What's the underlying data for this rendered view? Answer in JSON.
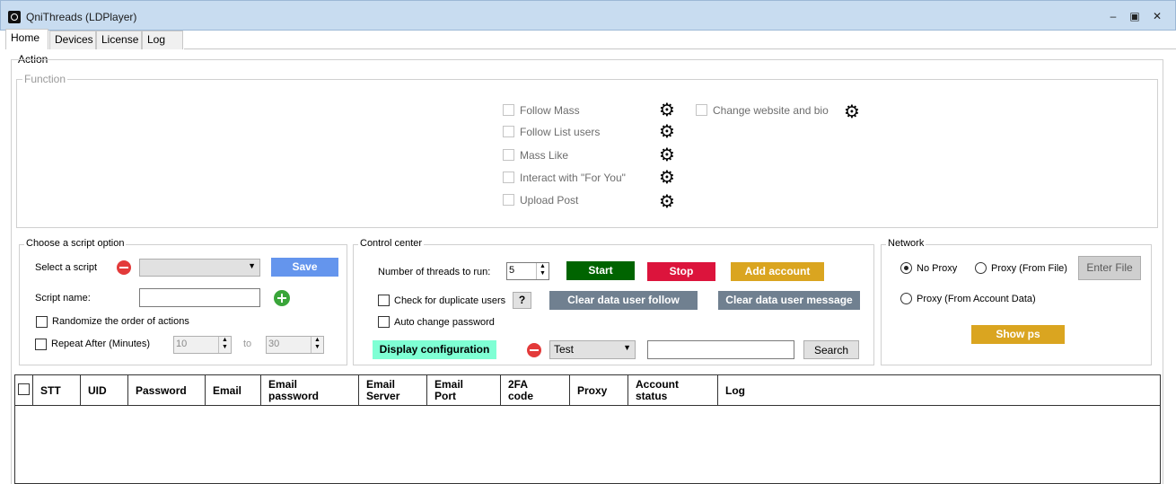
{
  "window": {
    "title": "QniThreads (LDPlayer)"
  },
  "tabs": [
    {
      "label": "Home"
    },
    {
      "label": "Devices"
    },
    {
      "label": "License"
    },
    {
      "label": "Log"
    }
  ],
  "action": {
    "label": "Action",
    "function_label": "Function",
    "functions_left": [
      {
        "label": "Follow Mass"
      },
      {
        "label": "Follow List users"
      },
      {
        "label": "Mass Like"
      },
      {
        "label": "Interact with \"For You\""
      },
      {
        "label": "Upload Post"
      }
    ],
    "functions_right": [
      {
        "label": "Change website and bio"
      }
    ]
  },
  "script_option": {
    "label": "Choose a script option",
    "select_label": "Select a script",
    "select_value": "",
    "save_label": "Save",
    "name_label": "Script name:",
    "name_value": "",
    "randomize_label": "Randomize the order of actions",
    "repeat_label": "Repeat After (Minutes)",
    "repeat_from": "10",
    "to_label": "to",
    "repeat_to": "30"
  },
  "control": {
    "label": "Control center",
    "threads_label": "Number of threads to run:",
    "threads_value": "5",
    "start_label": "Start",
    "stop_label": "Stop",
    "add_account_label": "Add account",
    "dup_label": "Check for duplicate users",
    "help_label": "?",
    "clear_follow_label": "Clear data user follow",
    "clear_message_label": "Clear data user message",
    "auto_change_label": "Auto change password",
    "display_config_label": "Display configuration",
    "config_value": "Test",
    "search_value": "",
    "search_label": "Search"
  },
  "network": {
    "label": "Network",
    "no_proxy_label": "No Proxy",
    "proxy_file_label": "Proxy (From File)",
    "enter_file_label": "Enter File",
    "proxy_account_label": "Proxy (From Account Data)",
    "show_ps_label": "Show ps",
    "selected": "No Proxy"
  },
  "table": {
    "columns": [
      {
        "label": "STT"
      },
      {
        "label": "UID"
      },
      {
        "label": "Password"
      },
      {
        "label": "Email"
      },
      {
        "label": "Email\npassword"
      },
      {
        "label": "Email\nServer"
      },
      {
        "label": "Email\nPort"
      },
      {
        "label": "2FA\ncode"
      },
      {
        "label": "Proxy"
      },
      {
        "label": "Account\nstatus"
      },
      {
        "label": "Log"
      }
    ],
    "rows": []
  },
  "colors": {
    "start": "#006400",
    "stop": "#dc143c",
    "add_account": "#daa520",
    "save": "#6495ed",
    "clear": "#708090",
    "display_config": "#7fffd4",
    "show_ps": "#daa520"
  }
}
